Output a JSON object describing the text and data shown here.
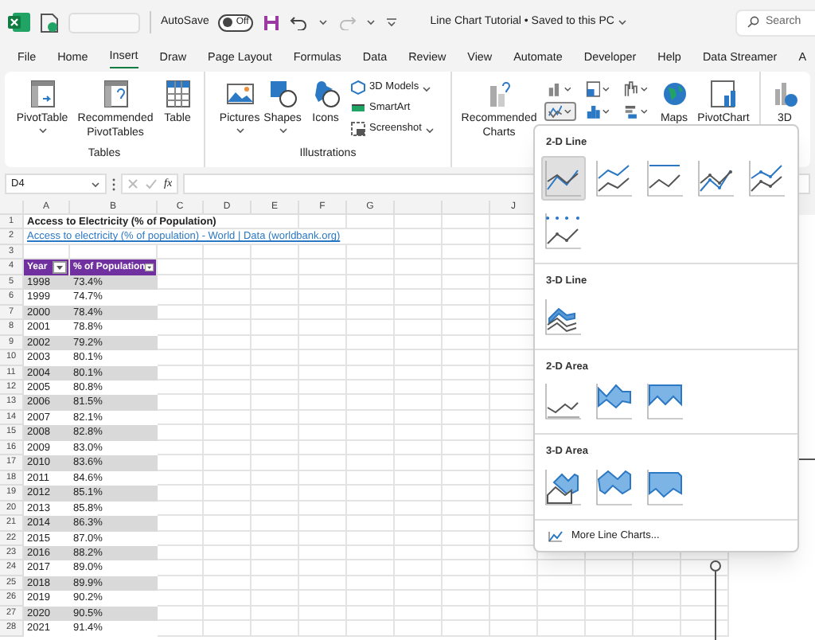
{
  "title_bar": {
    "autosave_label": "AutoSave",
    "autosave": {
      "on": false,
      "state": "Off"
    },
    "title": "Line Chart Tutorial • Saved to this PC",
    "search_placeholder": "Search"
  },
  "tabs": [
    {
      "label": "File",
      "selected": false
    },
    {
      "label": "Home",
      "selected": false
    },
    {
      "label": "Insert",
      "selected": true
    },
    {
      "label": "Draw",
      "selected": false
    },
    {
      "label": "Page Layout",
      "selected": false
    },
    {
      "label": "Formulas",
      "selected": false
    },
    {
      "label": "Data",
      "selected": false
    },
    {
      "label": "Review",
      "selected": false
    },
    {
      "label": "View",
      "selected": false
    },
    {
      "label": "Automate",
      "selected": false
    },
    {
      "label": "Developer",
      "selected": false
    },
    {
      "label": "Help",
      "selected": false
    },
    {
      "label": "Data Streamer",
      "selected": false
    },
    {
      "label": "A",
      "selected": false
    }
  ],
  "ribbon": {
    "tables": {
      "label": "Tables",
      "buttons": [
        {
          "label": "PivotTable",
          "kind": "pivot",
          "menu": true
        },
        {
          "label": "Recommended PivotTables",
          "kind": "rec-pivot",
          "menu": false
        },
        {
          "label": "Table",
          "kind": "table",
          "menu": false
        }
      ]
    },
    "illustrations": {
      "label": "Illustrations",
      "buttons": [
        {
          "label": "Pictures",
          "kind": "pictures",
          "menu": true
        },
        {
          "label": "Shapes",
          "kind": "shapes",
          "menu": true
        },
        {
          "label": "Icons",
          "kind": "icons",
          "menu": false
        }
      ],
      "small_buttons": [
        {
          "label": "3D Models",
          "kind": "cube",
          "menu": true
        },
        {
          "label": "SmartArt",
          "kind": "smartart",
          "menu": false
        },
        {
          "label": "Screenshot",
          "kind": "screenshot",
          "menu": true
        }
      ]
    },
    "charts": {
      "recommended": "Recommended Charts",
      "chart_buttons": [
        {
          "kind": "column",
          "selected": false
        },
        {
          "kind": "hierarchy",
          "selected": false
        },
        {
          "kind": "waterfall",
          "selected": false
        },
        {
          "kind": "line",
          "selected": true
        },
        {
          "kind": "statistic",
          "selected": false
        },
        {
          "kind": "combo",
          "selected": false
        }
      ],
      "maps": "Maps",
      "pivot_chart": "PivotChart",
      "three_d": "3D"
    }
  },
  "formula_bar": {
    "name_box": "D4",
    "fx": "fx"
  },
  "sheet": {
    "columns": [
      "A",
      "B",
      "C",
      "D",
      "E",
      "F",
      "G",
      "",
      "",
      "J"
    ],
    "row_headers": [
      "1",
      "2",
      "3",
      "4",
      "5",
      "6",
      "7",
      "8",
      "9",
      "10",
      "11",
      "12",
      "13",
      "14",
      "15",
      "16",
      "17",
      "18",
      "19",
      "20",
      "21",
      "22",
      "23",
      "24",
      "25",
      "26",
      "27",
      "28"
    ],
    "title": "Access to Electricity (% of Population)",
    "source_link": "Access to electricity (% of population) - World | Data (worldbank.org)",
    "table_headers": [
      "Year",
      "% of Population"
    ],
    "rows": [
      [
        "1998",
        "73.4%"
      ],
      [
        "1999",
        "74.7%"
      ],
      [
        "2000",
        "78.4%"
      ],
      [
        "2001",
        "78.8%"
      ],
      [
        "2002",
        "79.2%"
      ],
      [
        "2003",
        "80.1%"
      ],
      [
        "2004",
        "80.1%"
      ],
      [
        "2005",
        "80.8%"
      ],
      [
        "2006",
        "81.5%"
      ],
      [
        "2007",
        "82.1%"
      ],
      [
        "2008",
        "82.8%"
      ],
      [
        "2009",
        "83.0%"
      ],
      [
        "2010",
        "83.6%"
      ],
      [
        "2011",
        "84.6%"
      ],
      [
        "2012",
        "85.1%"
      ],
      [
        "2013",
        "85.8%"
      ],
      [
        "2014",
        "86.3%"
      ],
      [
        "2015",
        "87.0%"
      ],
      [
        "2016",
        "88.2%"
      ],
      [
        "2017",
        "89.0%"
      ],
      [
        "2018",
        "89.9%"
      ],
      [
        "2019",
        "90.2%"
      ],
      [
        "2020",
        "90.5%"
      ],
      [
        "2021",
        "91.4%"
      ]
    ]
  },
  "line_menu": {
    "sections": [
      {
        "title": "2-D Line",
        "items": [
          {
            "kind": "line",
            "selected": true
          },
          {
            "kind": "stacked-line",
            "selected": false
          },
          {
            "kind": "percent-line",
            "selected": false
          },
          {
            "kind": "line-markers",
            "selected": false
          },
          {
            "kind": "stacked-markers",
            "selected": false
          },
          {
            "kind": "percent-markers",
            "selected": false
          }
        ]
      },
      {
        "title": "3-D Line",
        "items": [
          {
            "kind": "line-3d",
            "selected": false
          }
        ]
      },
      {
        "title": "2-D Area",
        "items": [
          {
            "kind": "area",
            "selected": false
          },
          {
            "kind": "stacked-area",
            "selected": false
          },
          {
            "kind": "percent-area",
            "selected": false
          }
        ]
      },
      {
        "title": "3-D Area",
        "items": [
          {
            "kind": "area-3d",
            "selected": false
          },
          {
            "kind": "stacked-area-3d",
            "selected": false
          },
          {
            "kind": "percent-area-3d",
            "selected": false
          }
        ]
      }
    ],
    "more": "More Line Charts..."
  }
}
